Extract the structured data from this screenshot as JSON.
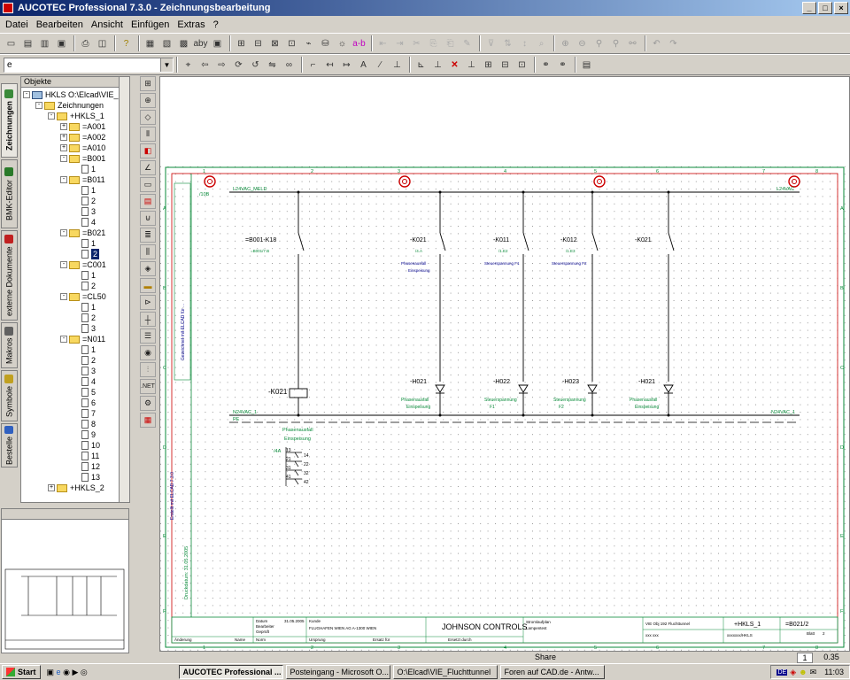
{
  "window": {
    "title": "AUCOTEC Professional 7.3.0 - Zeichnungsbearbeitung",
    "min": "_",
    "max": "□",
    "close": "×"
  },
  "menu": [
    "Datei",
    "Bearbeiten",
    "Ansicht",
    "Einfügen",
    "Extras",
    "?"
  ],
  "combo_value": "e",
  "vtabs": [
    "Zeichnungen",
    "BMK-Editor",
    "externe Dokumente",
    "Makros",
    "Symbole",
    "Bestelle"
  ],
  "tree": {
    "header": "Objekte",
    "items": [
      "HKLS O:\\Elcad\\VIE_I",
      "Zeichnungen",
      "+HKLS_1",
      "=A001",
      "=A002",
      "=A010",
      "=B001",
      "1",
      "=B011",
      "1",
      "2",
      "3",
      "4",
      "=B021",
      "1",
      "2",
      "=C001",
      "1",
      "2",
      "=CL50",
      "1",
      "2",
      "3",
      "=N011",
      "1",
      "2",
      "3",
      "4",
      "5",
      "6",
      "7",
      "8",
      "9",
      "10",
      "11",
      "12",
      "13",
      "+HKLS_2"
    ]
  },
  "drawing": {
    "cols": [
      "1",
      "2",
      "3",
      "4",
      "5",
      "6",
      "7",
      "8"
    ],
    "rows": [
      "A",
      "B",
      "C",
      "D",
      "E",
      "F"
    ],
    "top_bus": "L24VAC_MELD",
    "top_bus_ref": "/10B",
    "top_bus_right": "L24VAC",
    "bot_bus": "N24VAC_1",
    "bot_bus_pe": "PE",
    "bot_bus_right": "N24VAC_1",
    "contacts": [
      {
        "tag": "=B001-K18",
        "ref": "=B001/7.B",
        "desc1": "",
        "desc2": ""
      },
      {
        "tag": "-K021",
        "ref": "/4.A",
        "desc1": "Phasenausfall",
        "desc2": "Einspeisung"
      },
      {
        "tag": "-K011",
        "ref": "/1.E2",
        "desc1": "Steuerspannung F1",
        "desc2": ""
      },
      {
        "tag": "-K012",
        "ref": "/1.E3",
        "desc1": "Steuerspannung F2",
        "desc2": ""
      },
      {
        "tag": "-K021",
        "ref": "",
        "desc1": "",
        "desc2": ""
      }
    ],
    "lamps": [
      {
        "tag": "-H021",
        "desc1": "Phasenausfall",
        "desc2": "Einspeisung"
      },
      {
        "tag": "-H022",
        "desc1": "Steuerspannung",
        "desc2": "F1"
      },
      {
        "tag": "-H023",
        "desc1": "Steuerspannung",
        "desc2": "F2"
      },
      {
        "tag": "-H021",
        "desc1": "Phasenausfall",
        "desc2": "Einspeisung"
      }
    ],
    "relay": {
      "tag": "-K021",
      "title1": "Phasenausfall",
      "title2": "Einspeisung",
      "ref": "/4A",
      "pins": [
        "13",
        "14",
        "21",
        "22",
        "31",
        "32",
        "41",
        "42"
      ]
    },
    "side_note_1": "Gezeichnet mit ELCAD für ...",
    "side_note_2": "Erstellt mit ELCAD 7.3.0",
    "side_note_3": "Druckdatum: 31.05.2005",
    "titleblock": {
      "datum_label": "Datum",
      "datum_value": "31.05.2005",
      "bearbeiter": "Bearbeiter",
      "geprueft": "Geprüft",
      "norm": "Norm",
      "aenderung": "Änderung",
      "name": "Name",
      "kunde_label": "Kunde",
      "kunde": "FLUGHAFEN WIEN AG  A-1300 WIEN",
      "ursprung": "Ursprung",
      "ersatz_fuer": "Ersatz für",
      "ersetzt_durch": "Ersetzt durch",
      "logo": "JOHNSON CONTROLS",
      "plan1": "Stromlaufplan",
      "plan2": "Lampentest",
      "project": "VIE Obj 192 Fluchttunnel",
      "proj_sub": "xxx xxx",
      "sub2": "xxxxxxx/HKLS",
      "anlage": "+HKLS_1",
      "blatt": "=B021/2",
      "blatt_label": "Blatt",
      "blatt_no": "2"
    }
  },
  "status": {
    "share": "Share",
    "page": "1",
    "zoom": "0.35"
  },
  "taskbar": {
    "start": "Start",
    "buttons": [
      "AUCOTEC Professional ...",
      "Posteingang - Microsoft O...",
      "O:\\Elcad\\VIE_Fluchttunnel",
      "Foren auf CAD.de - Antw..."
    ],
    "time": "11:03"
  }
}
